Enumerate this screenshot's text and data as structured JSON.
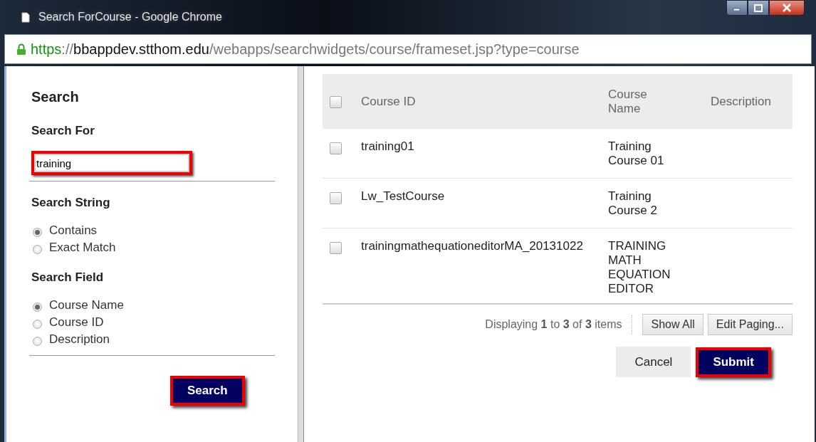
{
  "window": {
    "title": "Search ForCourse - Google Chrome"
  },
  "address_bar": {
    "scheme": "https",
    "separator": "://",
    "host": "bbappdev.stthom.edu",
    "path": "/webapps/searchwidgets/course/frameset.jsp?type=course"
  },
  "search_panel": {
    "heading": "Search",
    "search_for_label": "Search For",
    "search_for": {
      "value": "training",
      "highlighted": true
    },
    "search_string_label": "Search String",
    "search_string_options": [
      {
        "label": "Contains",
        "selected": true
      },
      {
        "label": "Exact Match",
        "selected": false
      }
    ],
    "search_field_label": "Search Field",
    "search_field_options": [
      {
        "label": "Course Name",
        "selected": true
      },
      {
        "label": "Course ID",
        "selected": false
      },
      {
        "label": "Description",
        "selected": false
      }
    ],
    "search_button": {
      "label": "Search",
      "highlighted": true
    }
  },
  "table": {
    "select_all_checked": false,
    "columns": [
      "Course ID",
      "Course Name",
      "Description"
    ],
    "rows": [
      {
        "checked": false,
        "course_id": "training01",
        "course_name": "Training Course 01"
      },
      {
        "checked": false,
        "course_id": "Lw_TestCourse",
        "course_name": "Training Course 2"
      },
      {
        "checked": false,
        "course_id": "trainingmathequationeditorMA_20131022",
        "course_name": "TRAINING MATH EQUATION EDITOR"
      }
    ]
  },
  "paging": {
    "summary": "Displaying **1** to **3** of **3** items",
    "buttons": [
      "Show All",
      "Edit Paging..."
    ]
  },
  "actions": {
    "cancel": {
      "label": "Cancel",
      "highlighted": false
    },
    "submit": {
      "label": "Submit",
      "highlighted": true
    }
  }
}
